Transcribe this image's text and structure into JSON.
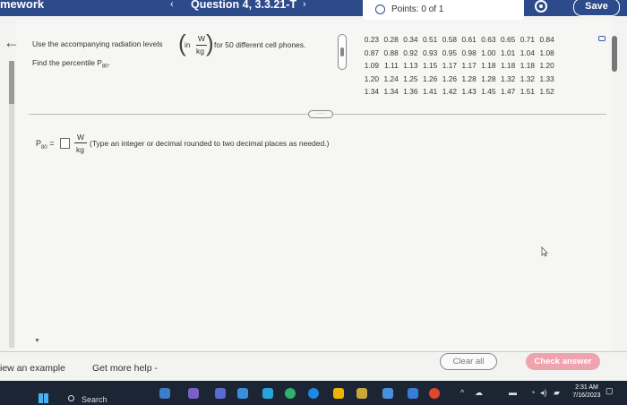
{
  "header": {
    "title": "mework",
    "prev_symbol": "‹",
    "question_label": "Question 4, 3.3.21-T",
    "next_symbol": "›",
    "points_text": "Points: 0 of 1",
    "save_label": "Save"
  },
  "question": {
    "prompt_start": "Use the accompanying radiation levels",
    "units_in": "in",
    "units_num": "W",
    "units_den": "kg",
    "prompt_end": "for 50 different cell phones.",
    "prompt_line2": "Find the percentile P",
    "prompt_line2_sub": "80",
    "prompt_line2_end": "."
  },
  "data_table": {
    "rows": [
      [
        "0.23",
        "0.28",
        "0.34",
        "0.51",
        "0.58",
        "0.61",
        "0.63",
        "0.65",
        "0.71",
        "0.84"
      ],
      [
        "0.87",
        "0.88",
        "0.92",
        "0.93",
        "0.95",
        "0.98",
        "1.00",
        "1.01",
        "1.04",
        "1.08"
      ],
      [
        "1.09",
        "1.11",
        "1.13",
        "1.15",
        "1.17",
        "1.17",
        "1.18",
        "1.18",
        "1.18",
        "1.20"
      ],
      [
        "1.20",
        "1.24",
        "1.25",
        "1.26",
        "1.26",
        "1.28",
        "1.28",
        "1.32",
        "1.32",
        "1.33"
      ],
      [
        "1.34",
        "1.34",
        "1.36",
        "1.41",
        "1.42",
        "1.43",
        "1.45",
        "1.47",
        "1.51",
        "1.52"
      ]
    ]
  },
  "divider_dots": "·····",
  "answer": {
    "label_p": "P",
    "label_sub": "80",
    "equals": "=",
    "unit_num": "W",
    "unit_den": "kg",
    "note": "(Type an integer or decimal rounded to two decimal places as needed.)"
  },
  "footer": {
    "view_example": "iew an example",
    "get_help": "Get more help -",
    "clear_all": "Clear all",
    "check_answer": "Check answer"
  },
  "taskbar": {
    "search_label": "Search",
    "time": "2:31 AM",
    "date": "7/16/2023"
  },
  "colors": {
    "header_bg": "#2d4a8a",
    "check_button": "#f0a3ae",
    "taskbar_bg": "#1c2533"
  }
}
